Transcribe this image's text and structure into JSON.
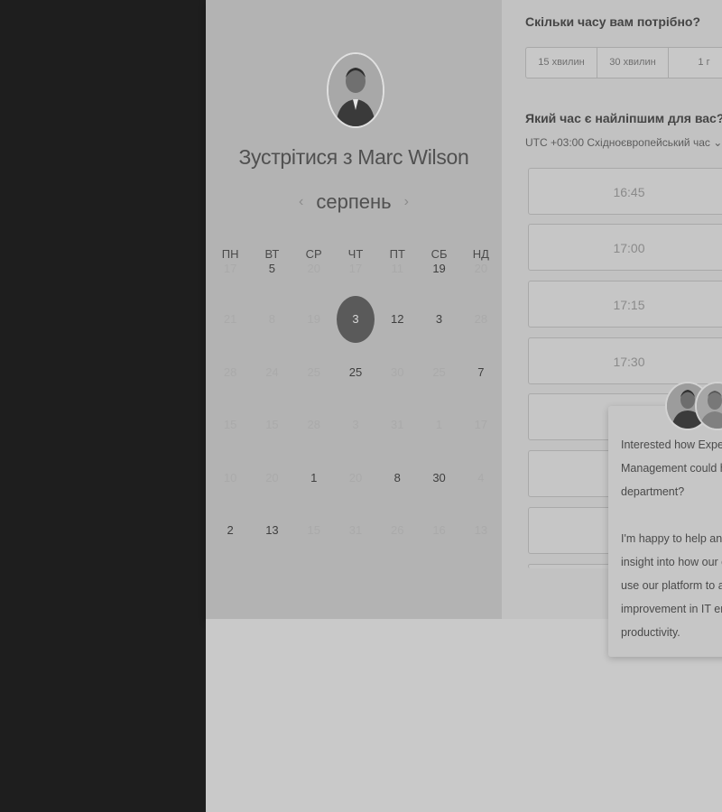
{
  "host": {
    "title": "Зустрітися з Marc Wilson"
  },
  "calendar": {
    "month": "серпень",
    "prev_icon": "‹",
    "next_icon": "›",
    "weekdays": [
      "ПН",
      "ВТ",
      "СР",
      "ЧТ",
      "ПТ",
      "СБ",
      "НД"
    ],
    "weeks": [
      [
        {
          "d": "17",
          "a": false
        },
        {
          "d": "5",
          "a": true
        },
        {
          "d": "20",
          "a": false
        },
        {
          "d": "17",
          "a": false
        },
        {
          "d": "11",
          "a": false
        },
        {
          "d": "19",
          "a": true
        },
        {
          "d": "20",
          "a": false
        }
      ],
      [
        {
          "d": "21",
          "a": false
        },
        {
          "d": "8",
          "a": false
        },
        {
          "d": "19",
          "a": false
        },
        {
          "d": "3",
          "a": true,
          "s": true
        },
        {
          "d": "12",
          "a": true
        },
        {
          "d": "3",
          "a": true
        },
        {
          "d": "28",
          "a": false
        }
      ],
      [
        {
          "d": "28",
          "a": false
        },
        {
          "d": "24",
          "a": false
        },
        {
          "d": "25",
          "a": false
        },
        {
          "d": "25",
          "a": true
        },
        {
          "d": "30",
          "a": false
        },
        {
          "d": "25",
          "a": false
        },
        {
          "d": "7",
          "a": true
        }
      ],
      [
        {
          "d": "15",
          "a": false
        },
        {
          "d": "15",
          "a": false
        },
        {
          "d": "28",
          "a": false
        },
        {
          "d": "3",
          "a": false
        },
        {
          "d": "31",
          "a": false
        },
        {
          "d": "1",
          "a": false
        },
        {
          "d": "17",
          "a": false
        }
      ],
      [
        {
          "d": "10",
          "a": false
        },
        {
          "d": "20",
          "a": false
        },
        {
          "d": "1",
          "a": true
        },
        {
          "d": "20",
          "a": false
        },
        {
          "d": "8",
          "a": true
        },
        {
          "d": "30",
          "a": true
        },
        {
          "d": "4",
          "a": false
        }
      ],
      [
        {
          "d": "2",
          "a": true
        },
        {
          "d": "13",
          "a": true
        },
        {
          "d": "15",
          "a": false
        },
        {
          "d": "31",
          "a": false
        },
        {
          "d": "26",
          "a": false
        },
        {
          "d": "16",
          "a": false
        },
        {
          "d": "13",
          "a": false
        }
      ]
    ]
  },
  "duration": {
    "question": "Скільки часу вам потрібно?",
    "options": [
      "15 хвилин",
      "30 хвилин",
      "1 г"
    ]
  },
  "time": {
    "question": "Який час є найліпшим для вас?",
    "timezone": "UTC +03:00 Східноєвропейський час  ⌄",
    "slots": [
      "16:45",
      "17:00",
      "17:15",
      "17:30"
    ]
  },
  "chat": {
    "lines": [
      "Interested how Experie",
      "Management could he",
      "department?",
      "",
      "I'm happy to help and",
      "insight into how our cu",
      "use our platform to ac",
      "improvement in IT end",
      "productivity."
    ]
  },
  "colors": {
    "selected_day": "#5a5a5a",
    "panel": "#b3b3b3"
  }
}
